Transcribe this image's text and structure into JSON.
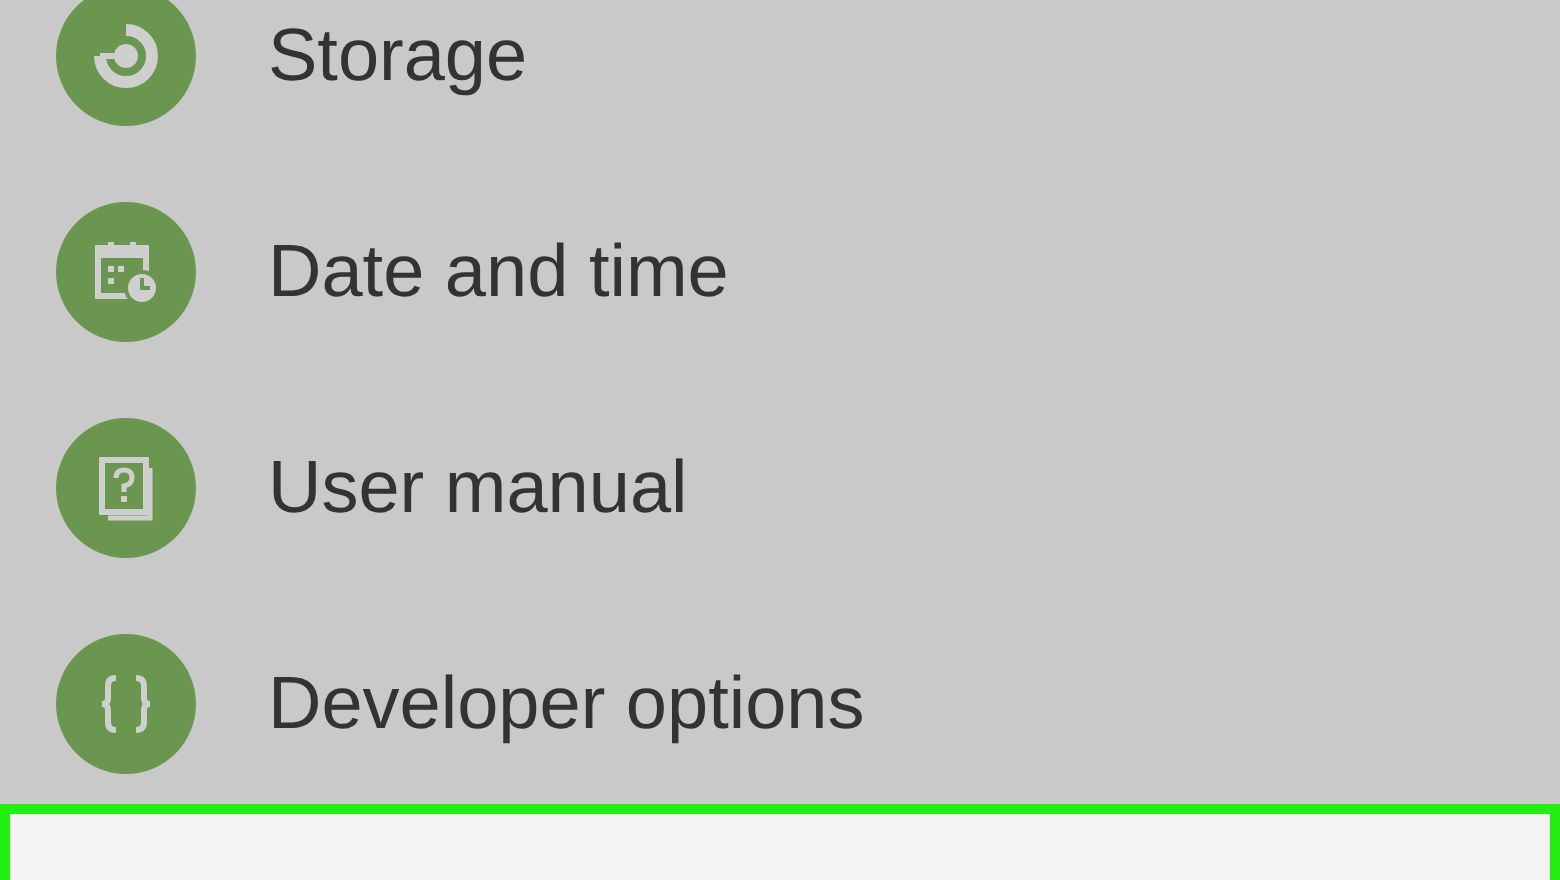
{
  "settings_items": [
    {
      "label": "Storage",
      "selected": false
    },
    {
      "label": "Date and time",
      "selected": false
    },
    {
      "label": "User manual",
      "selected": false
    },
    {
      "label": "Developer options",
      "selected": false
    },
    {
      "selected": true
    }
  ]
}
